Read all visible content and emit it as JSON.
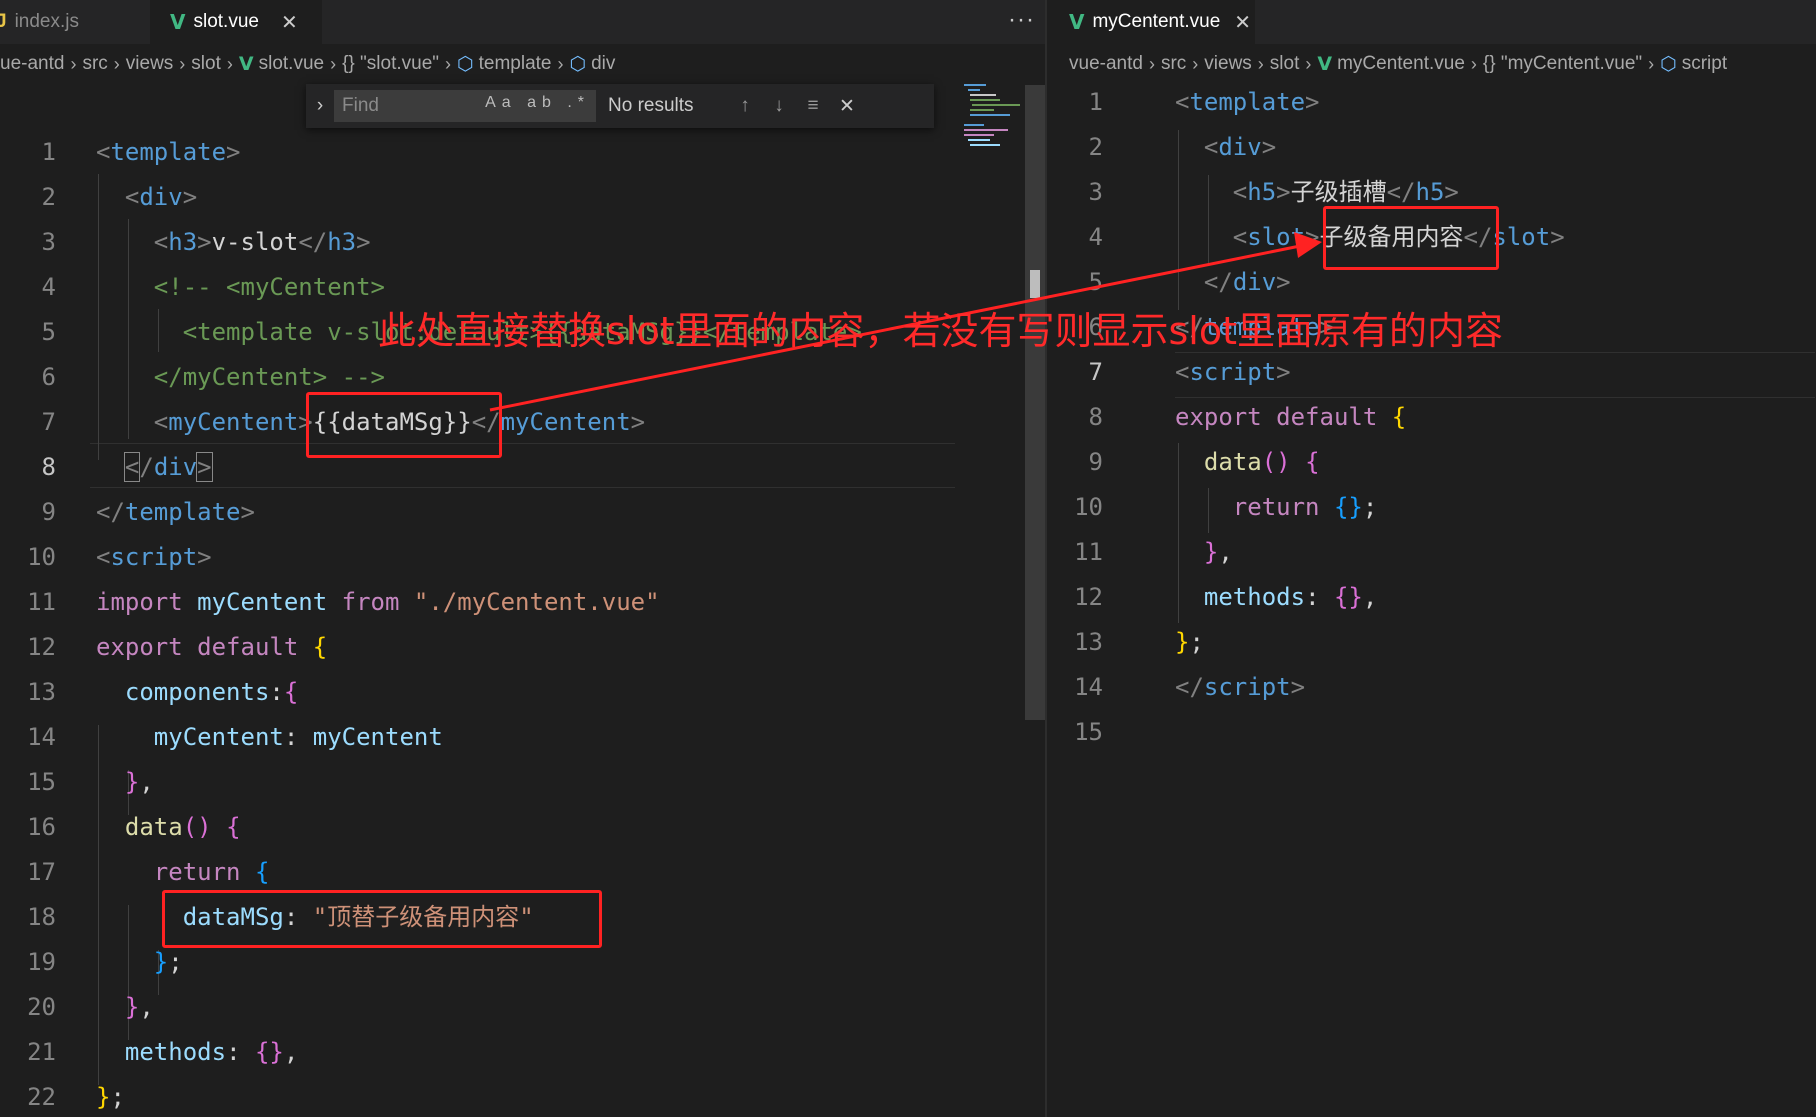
{
  "left": {
    "tabs": [
      {
        "icon": "JS",
        "label": "index.js",
        "active": false
      },
      {
        "icon": "V",
        "label": "slot.vue",
        "active": true,
        "close": "✕"
      }
    ],
    "more": "···",
    "breadcrumb": [
      "ue-antd",
      "src",
      "views",
      "slot",
      "slot.vue",
      "{} \"slot.vue\"",
      "template",
      "div"
    ],
    "find": {
      "placeholder": "Find",
      "options": "Aa ab .*",
      "result": "No results"
    },
    "line_numbers": [
      "1",
      "2",
      "3",
      "4",
      "5",
      "6",
      "7",
      "8",
      "9",
      "10",
      "11",
      "12",
      "13",
      "14",
      "15",
      "16",
      "17",
      "18",
      "19",
      "20",
      "21",
      "22"
    ],
    "code": {
      "l1": "template",
      "l2": "div",
      "l3_tag": "h3",
      "l3_text": "v-slot",
      "l4": "<!-- <myCentent>",
      "l5": "<template v-slot:default>{{dataMSg}}</template>",
      "l6": "</myCentent> -->",
      "l7_tag": "myCentent",
      "l7_expr": "{{dataMSg}}",
      "l8": "div",
      "l9": "template",
      "l10": "script",
      "l11_kw1": "import",
      "l11_var": "myCentent",
      "l11_kw2": "from",
      "l11_str": "\"./myCentent.vue\"",
      "l12_kw": "export default",
      "l13": "components",
      "l14_key": "myCentent",
      "l14_val": "myCentent",
      "l16": "data",
      "l17": "return",
      "l18_key": "dataMSg",
      "l18_str": "\"顶替子级备用内容\"",
      "l21": "methods"
    }
  },
  "right": {
    "tabs": [
      {
        "icon": "V",
        "label": "myCentent.vue",
        "active": true,
        "close": "✕"
      }
    ],
    "breadcrumb": [
      "vue-antd",
      "src",
      "views",
      "slot",
      "myCentent.vue",
      "{} \"myCentent.vue\"",
      "script"
    ],
    "line_numbers": [
      "1",
      "2",
      "3",
      "4",
      "5",
      "6",
      "7",
      "8",
      "9",
      "10",
      "11",
      "12",
      "13",
      "14",
      "15"
    ],
    "code": {
      "l1": "template",
      "l2": "div",
      "l3_tag": "h5",
      "l3_text": "子级插槽",
      "l4_tag": "slot",
      "l4_text": "子级备用内容",
      "l5": "div",
      "l6": "template",
      "l7": "script",
      "l8_kw": "export default",
      "l9": "data",
      "l10": "return",
      "l12": "methods"
    }
  },
  "annotation": "此处直接替换slot里面的内容，若没有写则显示slot里面原有的内容",
  "colors": {
    "annotation": "#ff2222",
    "tag": "#569cd6",
    "keyword": "#c586c0",
    "string": "#ce9178",
    "variable": "#9cdcfe"
  }
}
